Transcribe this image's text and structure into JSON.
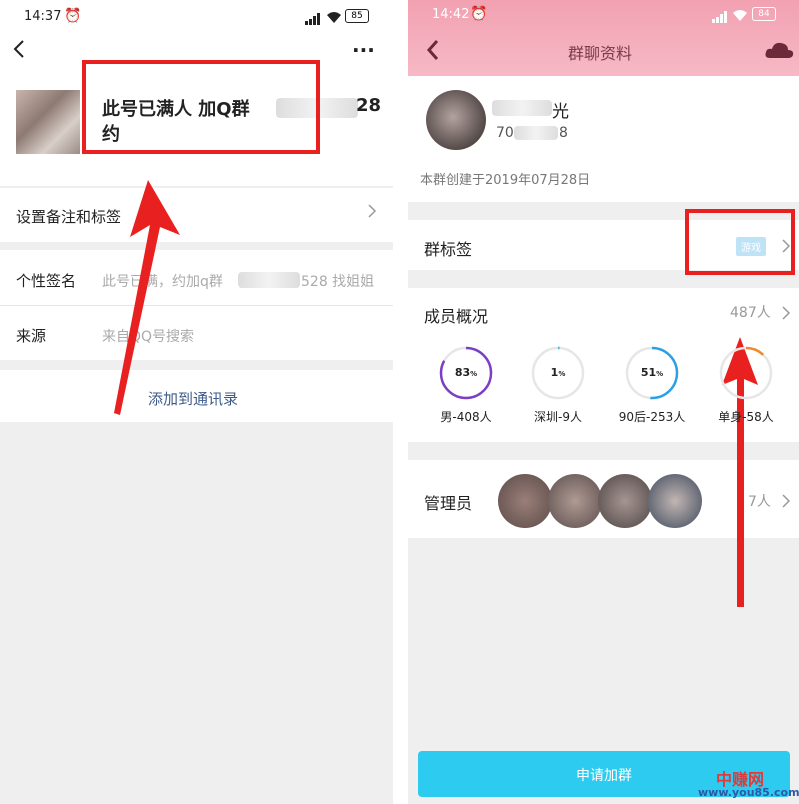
{
  "left": {
    "status_time": "14:37",
    "battery": "85",
    "headline_line1": "此号已满人 加Q群",
    "headline_suffix": "28",
    "headline_line2": "约",
    "more_icon": "···",
    "settings_row": "设置备注和标签",
    "signature_label": "个性签名",
    "signature_value_a": "此号已满，约加q群",
    "signature_value_b": "528 找姐姐",
    "source_label": "来源",
    "source_value": "来自QQ号搜索",
    "add_contact": "添加到通讯录"
  },
  "right": {
    "status_time": "14:42",
    "battery": "84",
    "title": "群聊资料",
    "group_name_suffix": "光",
    "group_id_prefix": "70",
    "group_id_suffix": "8",
    "created": "本群创建于2019年07月28日",
    "tag_label": "群标签",
    "tag_value": "游戏",
    "members_label": "成员概况",
    "members_count": "487人",
    "stats": [
      {
        "num": "83",
        "unit": "%",
        "label": "男-408人",
        "pct": 83,
        "color": "#7b3fc4"
      },
      {
        "num": "1",
        "unit": "%",
        "label": "深圳-9人",
        "pct": 1,
        "color": "#3fb3e6"
      },
      {
        "num": "51",
        "unit": "%",
        "label": "90后-253人",
        "pct": 51,
        "color": "#2ba0e6"
      },
      {
        "num": "",
        "unit": "",
        "label": "单身-58人",
        "pct": 12,
        "color": "#f08a2a"
      }
    ],
    "admins_label": "管理员",
    "admins_count": "7人",
    "join_button": "申请加群"
  },
  "watermark": {
    "brand": "中赚网",
    "url": "www.you85.com"
  },
  "colors": {
    "accent_red": "#e8201f",
    "header_pink": "#f3a7b5",
    "join_button": "#2ecbf0",
    "link_blue": "#3e5a8a"
  }
}
